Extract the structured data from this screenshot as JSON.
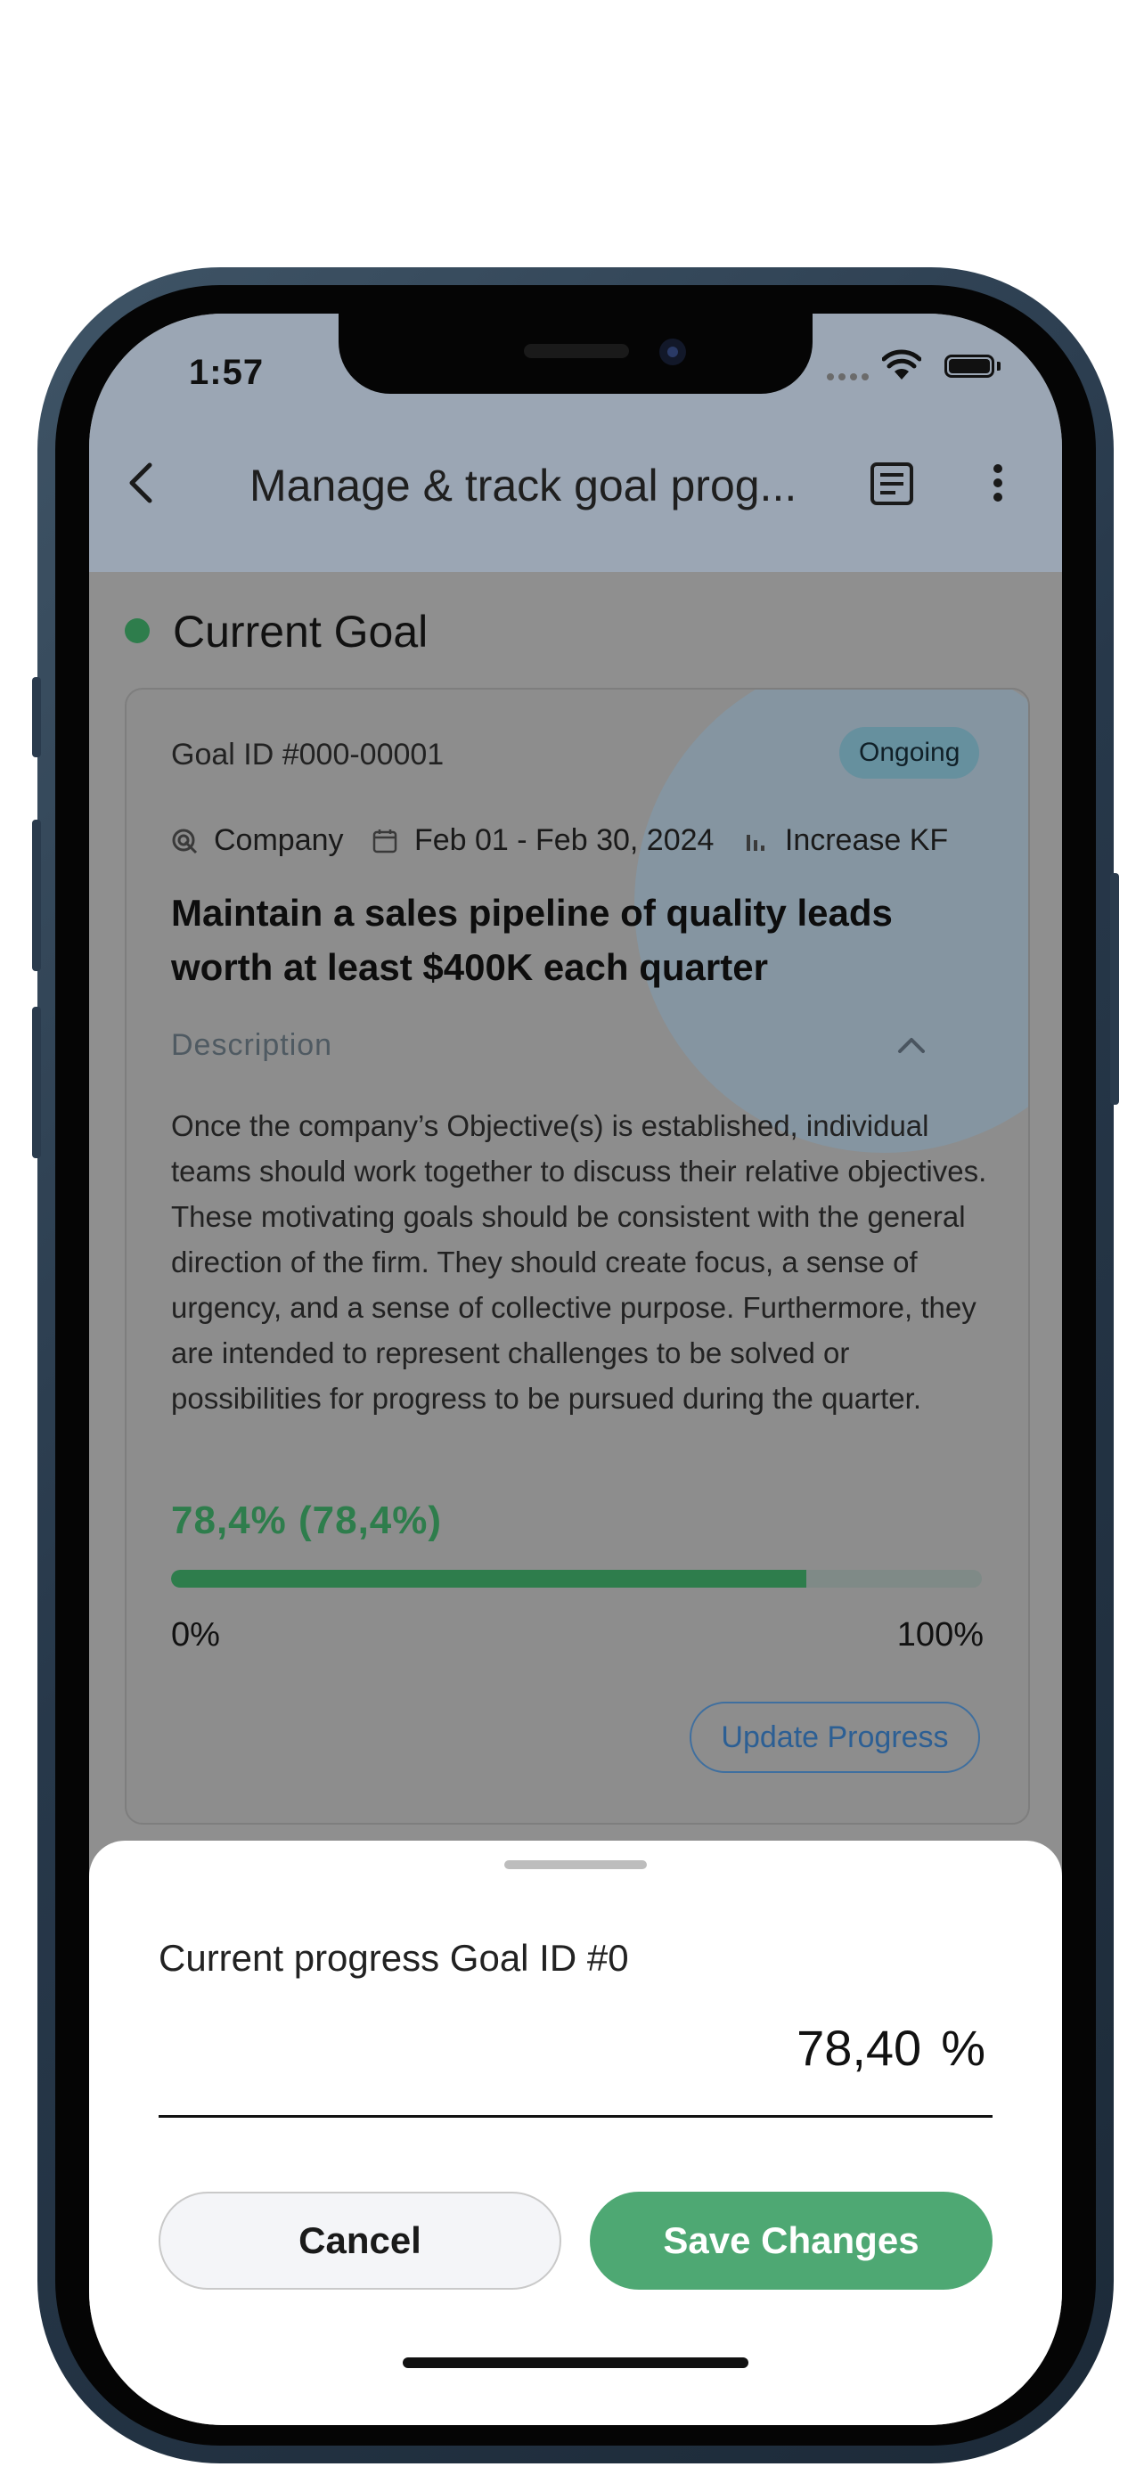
{
  "status_bar": {
    "time": "1:57"
  },
  "app_bar": {
    "title": "Manage & track goal prog...",
    "back_icon": "chevron-left-icon",
    "document_icon": "document-icon",
    "more_icon": "more-vertical-icon"
  },
  "section": {
    "title": "Current Goal",
    "dot_color": "#2e7d4c"
  },
  "goal_card": {
    "goal_id": "Goal ID #000-00001",
    "status": "Ongoing",
    "meta": {
      "scope": "Company",
      "date_range": "Feb 01 - Feb 30, 2024",
      "goal_type": "Increase KF"
    },
    "title": "Maintain a sales pipeline of quality leads worth at least $400K each quarter",
    "description_label": "Description",
    "description": "Once the company’s Objective(s) is established, individual teams should work together to discuss their relative objectives. These motivating goals should be consistent with the general direction of the firm. They should create focus, a sense of urgency, and a sense of collective purpose. Furthermore, they are intended to represent challenges to be solved or possibilities for progress to be pursued during the quarter.",
    "progress_label": "78,4% (78,4%)",
    "progress_fraction": 0.784,
    "progress_min": "0%",
    "progress_max": "100%",
    "update_button": "Update Progress"
  },
  "sheet": {
    "label": "Current progress Goal ID #0",
    "value": "78,40",
    "unit": "%",
    "cancel_button": "Cancel",
    "save_button": "Save Changes"
  },
  "colors": {
    "accent_green": "#2e7d4c",
    "save_button": "#4ea873",
    "status_badge": "#66909e",
    "link_blue": "#2c5f94"
  }
}
